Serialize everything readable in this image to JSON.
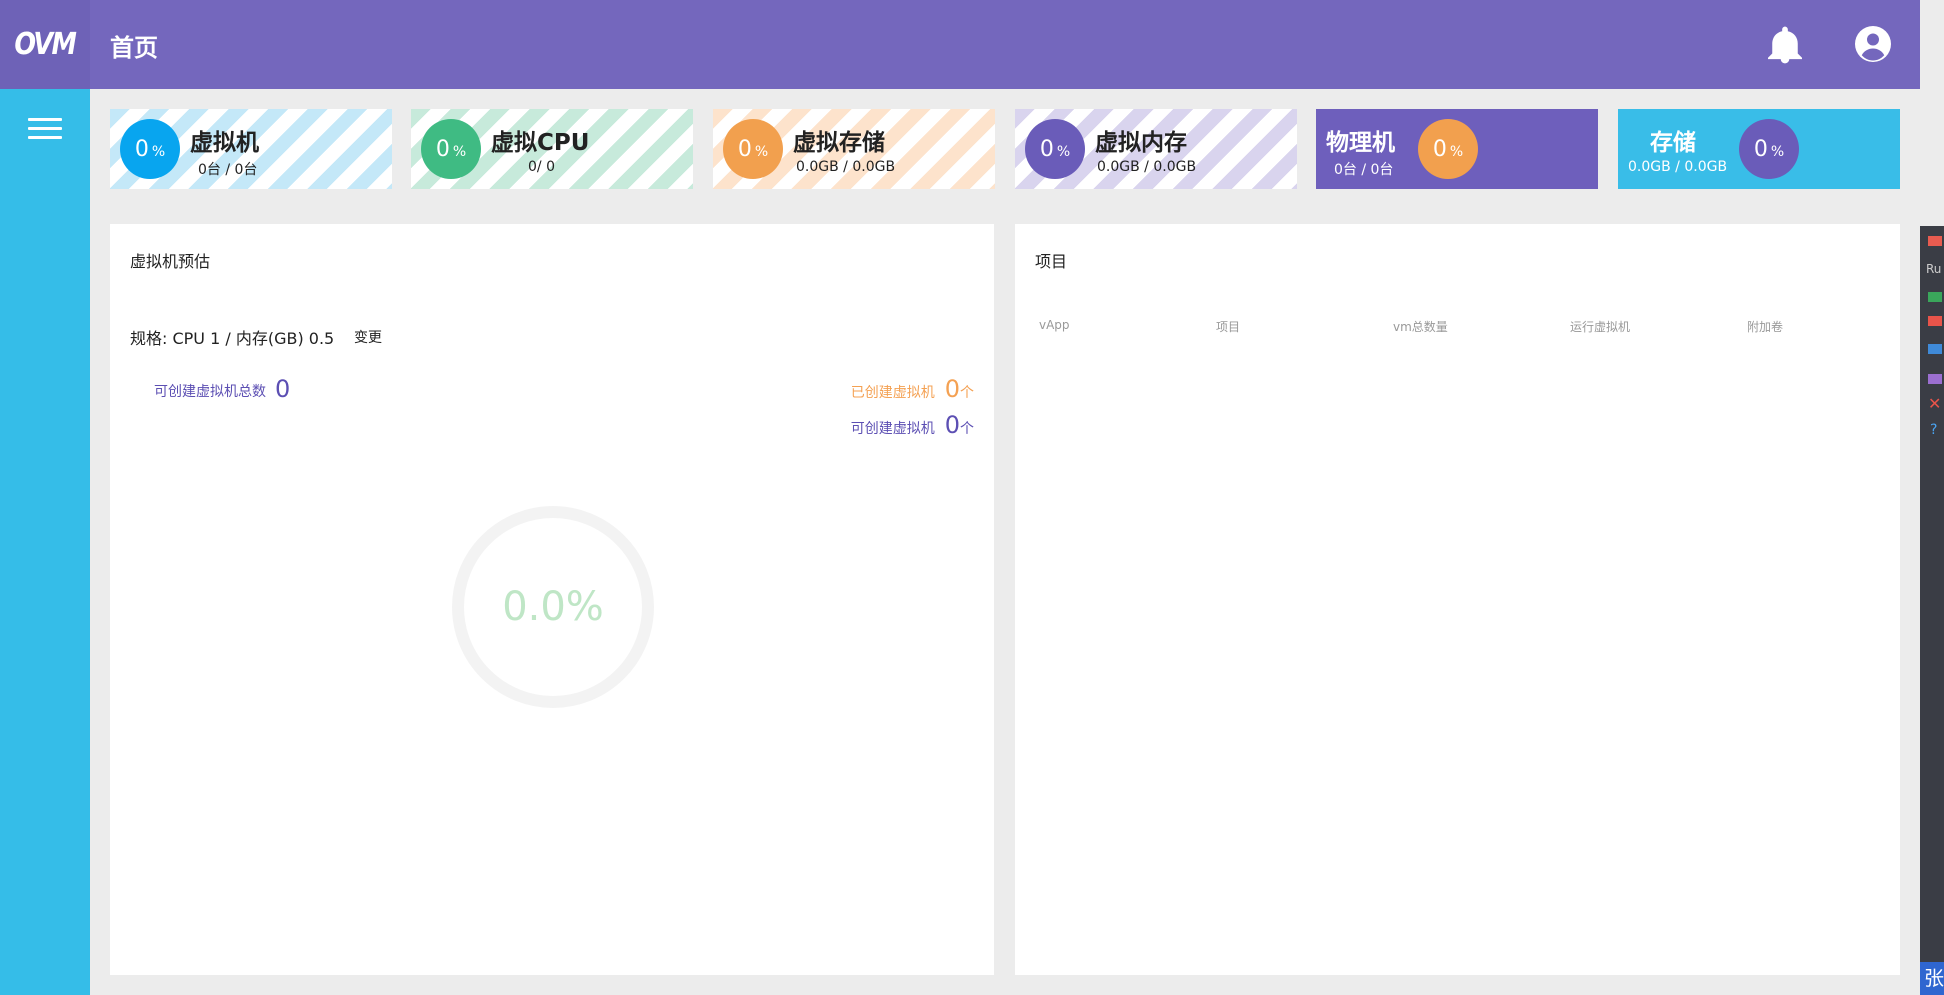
{
  "app": {
    "logo": "OVM",
    "page_title": "首页"
  },
  "colors": {
    "header": "#7467bd",
    "sidebar": "#35bde8",
    "logo_bg": "#6e62b7",
    "blue": "#08a5ef",
    "green": "#3fbb83",
    "orange": "#f2a04e",
    "purple": "#6a5cb9"
  },
  "cards": [
    {
      "title": "虚拟机",
      "percent": "0",
      "unit": "%",
      "sub": "0台 / 0台"
    },
    {
      "title": "虚拟CPU",
      "percent": "0",
      "unit": "%",
      "sub": "0/ 0"
    },
    {
      "title": "虚拟存储",
      "percent": "0",
      "unit": "%",
      "sub": "0.0GB / 0.0GB"
    },
    {
      "title": "虚拟内存",
      "percent": "0",
      "unit": "%",
      "sub": "0.0GB / 0.0GB"
    },
    {
      "title": "物理机",
      "percent": "0",
      "unit": "%",
      "sub": "0台 / 0台"
    },
    {
      "title": "存储",
      "percent": "0",
      "unit": "%",
      "sub": "0.0GB / 0.0GB"
    }
  ],
  "estimate": {
    "title": "虚拟机预估",
    "spec": "规格: CPU 1 / 内存(GB) 0.5",
    "change_label": "变更",
    "total_label": "可创建虚拟机总数",
    "total_value": "0",
    "created_label": "已创建虚拟机",
    "created_value": "0",
    "available_label": "可创建虚拟机",
    "available_value": "0",
    "unit": "个",
    "usage": "0.0%",
    "usage_fraction": 0.0
  },
  "projects": {
    "title": "项目",
    "columns": [
      "vApp",
      "项目",
      "vm总数量",
      "运行虚拟机",
      "附加卷"
    ],
    "rows": []
  },
  "edge": {
    "text_ru": "Ru",
    "bottom_char": "张"
  },
  "icons": {
    "bell": "bell-icon",
    "user": "user-circle-icon",
    "menu": "hamburger-menu-icon"
  }
}
